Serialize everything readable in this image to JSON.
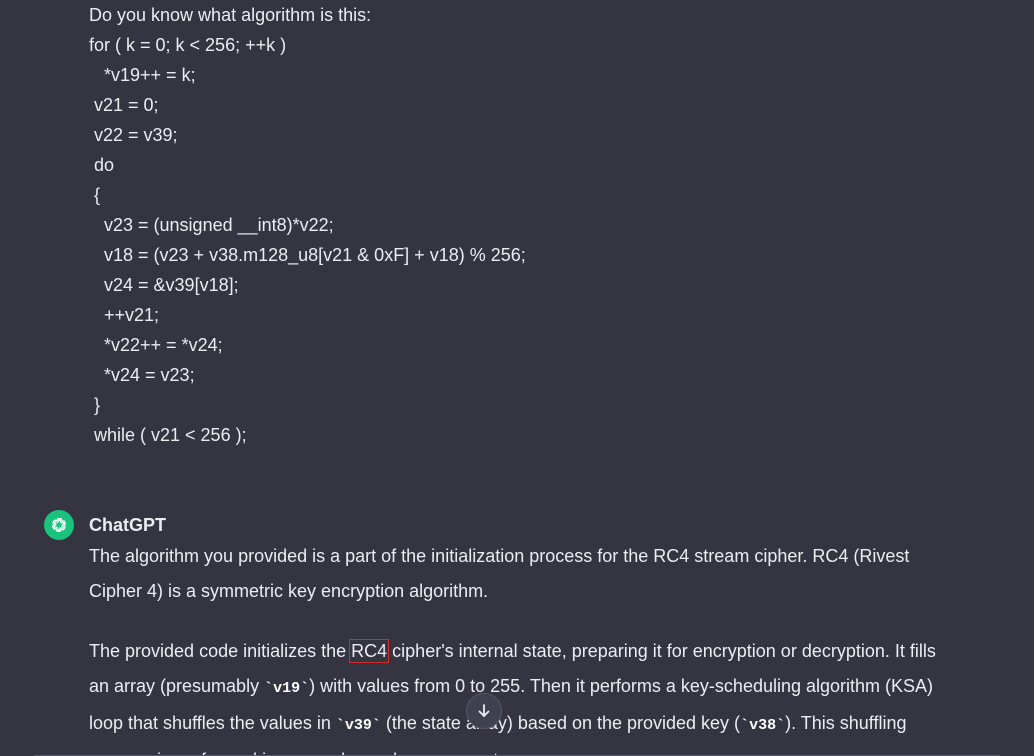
{
  "user": {
    "lines": [
      "Do you know what algorithm is this:",
      "for ( k = 0; k < 256; ++k )",
      "   *v19++ = k;",
      " v21 = 0;",
      " v22 = v39;",
      " do",
      " {",
      "   v23 = (unsigned __int8)*v22;",
      "   v18 = (v23 + v38.m128_u8[v21 & 0xF] + v18) % 256;",
      "   v24 = &v39[v18];",
      "   ++v21;",
      "   *v22++ = *v24;",
      "   *v24 = v23;",
      " }",
      " while ( v21 < 256 );"
    ]
  },
  "assistant": {
    "name": "ChatGPT",
    "avatar_icon": "openai-logo-icon",
    "avatar_color": "#19c37d",
    "p1": "The algorithm you provided is a part of the initialization process for the RC4 stream cipher. RC4 (Rivest Cipher 4) is a symmetric key encryption algorithm.",
    "p2": {
      "t1": "The provided code initializes the ",
      "hl": "RC4",
      "t2": " cipher's internal state, preparing it for encryption or decryption. It fills an array (presumably ",
      "c1": "`v19`",
      "t3": ") with values from 0 to 255. Then it performs a key-scheduling algorithm (KSA) loop that shuffles the values in ",
      "c2": "`v39`",
      "t4": " (the state array) based on the provided key (",
      "c3": "`v38`",
      "t5": "). This shuffling process is performed in a pseudo-random manner to ensure"
    }
  },
  "ui": {
    "scroll_icon": "arrow-down-icon",
    "highlight_color": "#d12b2b"
  }
}
